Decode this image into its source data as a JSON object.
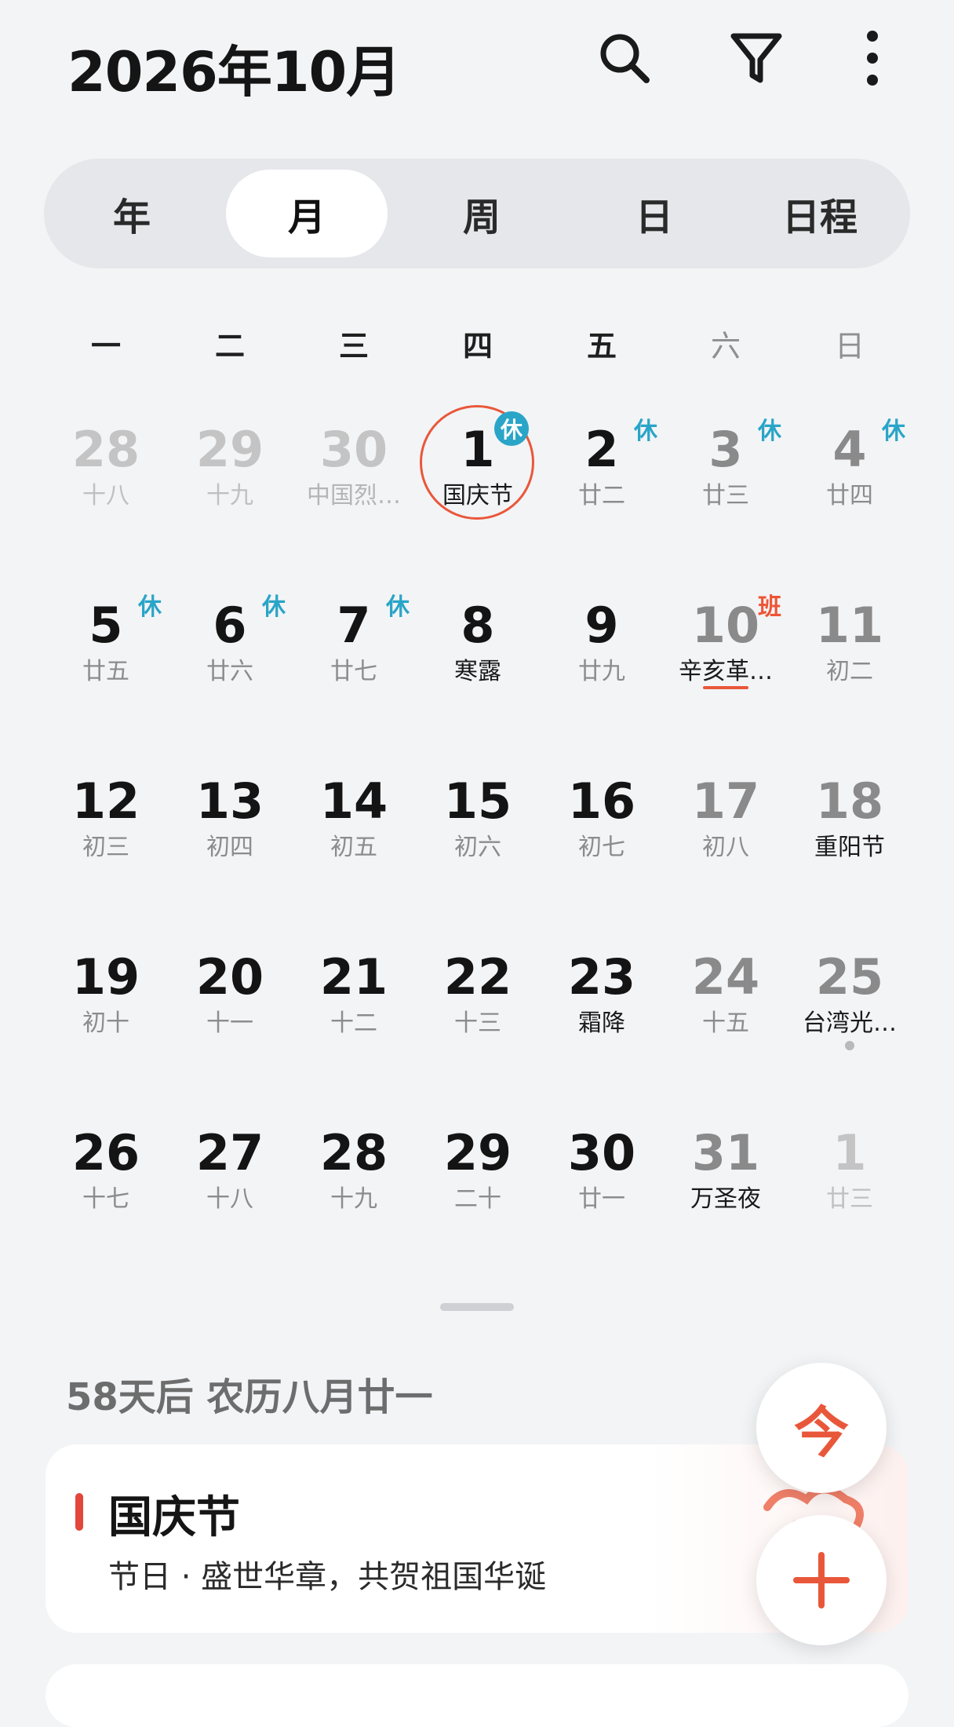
{
  "header": {
    "title": "2026年10月"
  },
  "view_tabs": [
    {
      "label": "年",
      "active": false
    },
    {
      "label": "月",
      "active": true
    },
    {
      "label": "周",
      "active": false
    },
    {
      "label": "日",
      "active": false
    },
    {
      "label": "日程",
      "active": false
    }
  ],
  "weekdays": [
    "一",
    "二",
    "三",
    "四",
    "五",
    "六",
    "日"
  ],
  "weeks": [
    [
      {
        "day": "28",
        "sub": "十八",
        "other": true
      },
      {
        "day": "29",
        "sub": "十九",
        "other": true
      },
      {
        "day": "30",
        "sub": "中国烈…",
        "other": true,
        "fest": true
      },
      {
        "day": "1",
        "sub": "国庆节",
        "fest": true,
        "today": true,
        "badge": "休"
      },
      {
        "day": "2",
        "sub": "廿二",
        "badge": "休"
      },
      {
        "day": "3",
        "sub": "廿三",
        "badge": "休"
      },
      {
        "day": "4",
        "sub": "廿四",
        "badge": "休"
      }
    ],
    [
      {
        "day": "5",
        "sub": "廿五",
        "badge": "休"
      },
      {
        "day": "6",
        "sub": "廿六",
        "badge": "休"
      },
      {
        "day": "7",
        "sub": "廿七",
        "badge": "休"
      },
      {
        "day": "8",
        "sub": "寒露",
        "fest": true
      },
      {
        "day": "9",
        "sub": "廿九"
      },
      {
        "day": "10",
        "sub": "辛亥革…",
        "fest": true,
        "badge": "班",
        "badge_work": true,
        "underline": true
      },
      {
        "day": "11",
        "sub": "初二"
      }
    ],
    [
      {
        "day": "12",
        "sub": "初三"
      },
      {
        "day": "13",
        "sub": "初四"
      },
      {
        "day": "14",
        "sub": "初五"
      },
      {
        "day": "15",
        "sub": "初六"
      },
      {
        "day": "16",
        "sub": "初七"
      },
      {
        "day": "17",
        "sub": "初八"
      },
      {
        "day": "18",
        "sub": "重阳节",
        "fest": true
      }
    ],
    [
      {
        "day": "19",
        "sub": "初十"
      },
      {
        "day": "20",
        "sub": "十一"
      },
      {
        "day": "21",
        "sub": "十二"
      },
      {
        "day": "22",
        "sub": "十三"
      },
      {
        "day": "23",
        "sub": "霜降",
        "fest": true
      },
      {
        "day": "24",
        "sub": "十五"
      },
      {
        "day": "25",
        "sub": "台湾光…",
        "fest": true,
        "dot": true
      }
    ],
    [
      {
        "day": "26",
        "sub": "十七"
      },
      {
        "day": "27",
        "sub": "十八"
      },
      {
        "day": "28",
        "sub": "十九"
      },
      {
        "day": "29",
        "sub": "二十"
      },
      {
        "day": "30",
        "sub": "廿一"
      },
      {
        "day": "31",
        "sub": "万圣夜",
        "fest": true
      },
      {
        "day": "1",
        "sub": "廿三",
        "other": true
      }
    ]
  ],
  "info": {
    "text": "58天后 农历八月廿一"
  },
  "event_card": {
    "title": "国庆节",
    "subtitle": "节日 · 盛世华章，共贺祖国华诞"
  },
  "fab": {
    "today_label": "今"
  },
  "colors": {
    "accent": "#e9573a",
    "rest_badge": "#2aa5c8",
    "work_badge": "#ee5535"
  }
}
